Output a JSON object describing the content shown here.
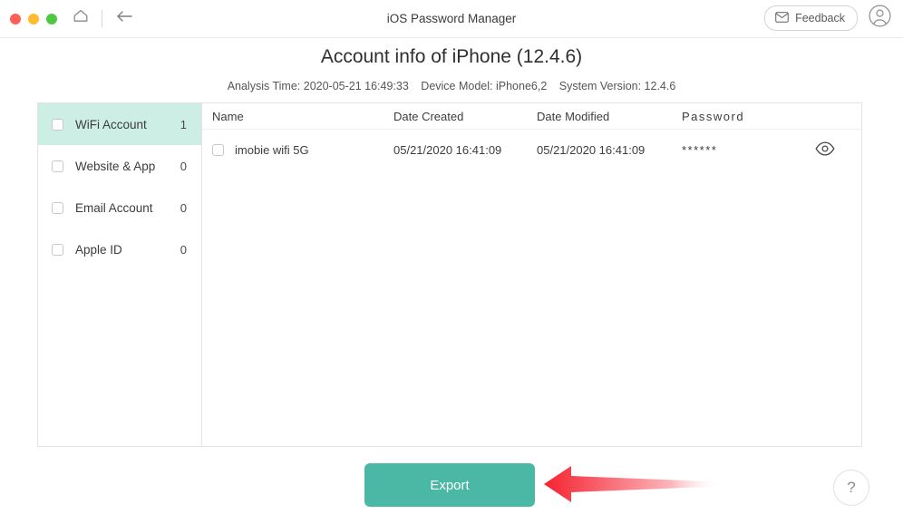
{
  "window": {
    "title": "iOS Password Manager",
    "traffic_lights": [
      "close",
      "minimize",
      "zoom"
    ],
    "home_icon": "home-icon",
    "back_icon": "back-arrow-icon",
    "feedback_label": "Feedback",
    "feedback_icon": "envelope-icon",
    "account_icon": "user-account-icon"
  },
  "header": {
    "title": "Account info of iPhone (12.4.6)",
    "analysis_time": "Analysis Time: 2020-05-21 16:49:33",
    "device_model": "Device Model: iPhone6,2",
    "system_version": "System Version: 12.4.6"
  },
  "sidebar": {
    "items": [
      {
        "label": "WiFi Account",
        "count": "1",
        "selected": true
      },
      {
        "label": "Website & App",
        "count": "0",
        "selected": false
      },
      {
        "label": "Email Account",
        "count": "0",
        "selected": false
      },
      {
        "label": "Apple ID",
        "count": "0",
        "selected": false
      }
    ]
  },
  "table": {
    "columns": [
      "Name",
      "Date Created",
      "Date Modified",
      "Password"
    ],
    "rows": [
      {
        "name": "imobie wifi 5G",
        "date_created": "05/21/2020 16:41:09",
        "date_modified": "05/21/2020 16:41:09",
        "password": "******",
        "reveal_icon": "eye-icon"
      }
    ]
  },
  "footer": {
    "export_label": "Export",
    "help_label": "?"
  },
  "colors": {
    "accent_teal": "#4bb8a5",
    "selected_row": "#cdeee5",
    "arrow_red": "#f5333f",
    "border_gray": "#e3e3e3"
  }
}
